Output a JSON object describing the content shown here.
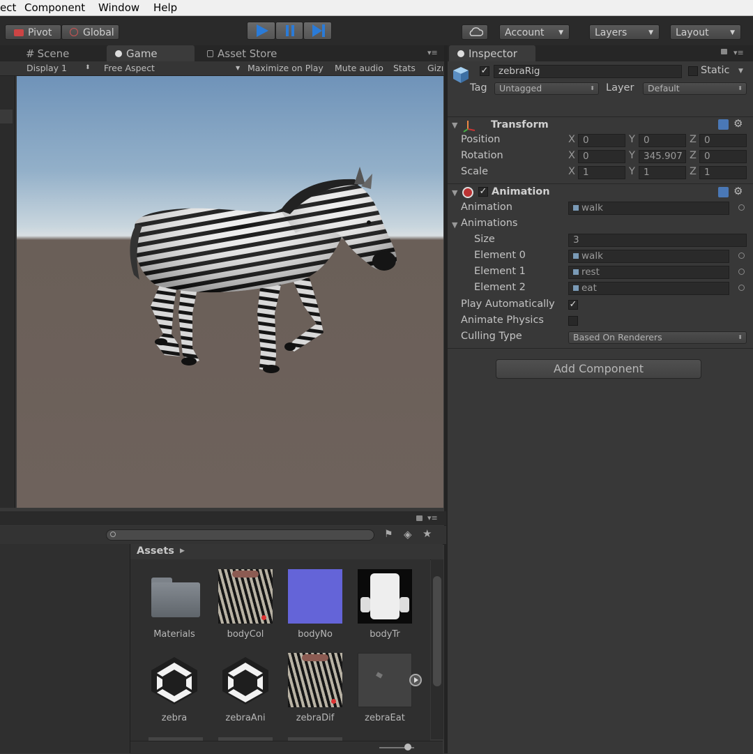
{
  "menubar": {
    "items": [
      "ect",
      "Component",
      "Window",
      "Help"
    ]
  },
  "toolbar": {
    "pivot": "Pivot",
    "global": "Global",
    "account": "Account",
    "layers": "Layers",
    "layout": "Layout"
  },
  "tabs": {
    "scene": "Scene",
    "game": "Game",
    "asset_store": "Asset Store",
    "inspector": "Inspector"
  },
  "game_toolbar": {
    "display": "Display 1",
    "aspect": "Free Aspect",
    "maximize": "Maximize on Play",
    "mute": "Mute audio",
    "stats": "Stats",
    "gizmos": "Gizı"
  },
  "inspector": {
    "object_name": "zebraRig",
    "active": true,
    "static_label": "Static",
    "tag_label": "Tag",
    "tag_value": "Untagged",
    "layer_label": "Layer",
    "layer_value": "Default",
    "transform": {
      "title": "Transform",
      "position_label": "Position",
      "rotation_label": "Rotation",
      "scale_label": "Scale",
      "x": "X",
      "y": "Y",
      "z": "Z",
      "position": [
        "0",
        "0",
        "0"
      ],
      "rotation": [
        "0",
        "345.907",
        "0"
      ],
      "scale": [
        "1",
        "1",
        "1"
      ]
    },
    "animation": {
      "title": "Animation",
      "animation_label": "Animation",
      "animation_value": "walk",
      "animations_label": "Animations",
      "size_label": "Size",
      "size_value": "3",
      "elements": [
        {
          "label": "Element 0",
          "value": "walk"
        },
        {
          "label": "Element 1",
          "value": "rest"
        },
        {
          "label": "Element 2",
          "value": "eat"
        }
      ],
      "play_auto_label": "Play Automatically",
      "play_auto": true,
      "animate_physics_label": "Animate Physics",
      "animate_physics": false,
      "culling_label": "Culling Type",
      "culling_value": "Based On Renderers"
    },
    "add_component": "Add Component"
  },
  "project": {
    "breadcrumb": "Assets",
    "assets": [
      {
        "name": "Materials",
        "kind": "folder"
      },
      {
        "name": "bodyCol",
        "kind": "texture-zebra"
      },
      {
        "name": "bodyNo",
        "kind": "texture-normal"
      },
      {
        "name": "bodyTr",
        "kind": "texture-mask"
      },
      {
        "name": "zebra",
        "kind": "unity-model"
      },
      {
        "name": "zebraAni",
        "kind": "unity-model"
      },
      {
        "name": "zebraDif",
        "kind": "texture-zebra"
      },
      {
        "name": "zebraEat",
        "kind": "animation-clip"
      }
    ]
  },
  "colors": {
    "accent_play": "#2a7bd8",
    "panel": "#383838",
    "toolbar": "#2a2a2a"
  }
}
